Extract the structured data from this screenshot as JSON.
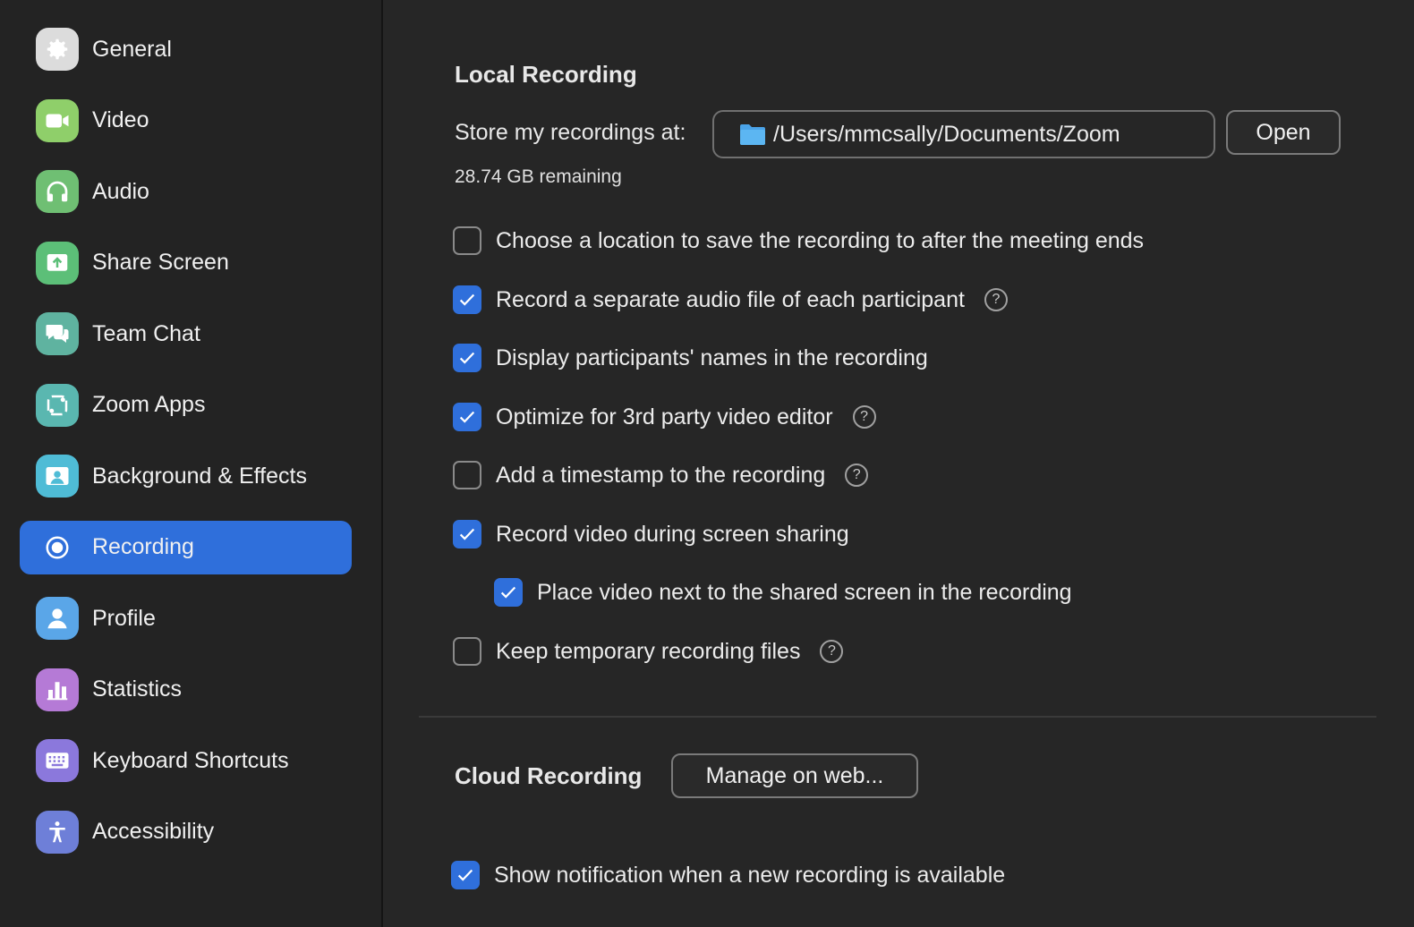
{
  "sidebar": {
    "items": [
      {
        "label": "General",
        "icon": "gear-icon",
        "color": "#dcdcdc",
        "active": false
      },
      {
        "label": "Video",
        "icon": "video-camera-icon",
        "color": "#8fcf6a",
        "active": false
      },
      {
        "label": "Audio",
        "icon": "headphones-icon",
        "color": "#6fbf73",
        "active": false
      },
      {
        "label": "Share Screen",
        "icon": "share-screen-icon",
        "color": "#5cbf78",
        "active": false
      },
      {
        "label": "Team Chat",
        "icon": "chat-bubbles-icon",
        "color": "#5fb3a0",
        "active": false
      },
      {
        "label": "Zoom Apps",
        "icon": "apps-icon",
        "color": "#5ab7b0",
        "active": false
      },
      {
        "label": "Background & Effects",
        "icon": "background-portrait-icon",
        "color": "#4fbcd6",
        "active": false
      },
      {
        "label": "Recording",
        "icon": "record-icon",
        "color": "#2f6fdb",
        "active": true
      },
      {
        "label": "Profile",
        "icon": "person-icon",
        "color": "#5aa6e8",
        "active": false
      },
      {
        "label": "Statistics",
        "icon": "bar-chart-icon",
        "color": "#b57ad6",
        "active": false
      },
      {
        "label": "Keyboard Shortcuts",
        "icon": "keyboard-icon",
        "color": "#8b78dc",
        "active": false
      },
      {
        "label": "Accessibility",
        "icon": "accessibility-icon",
        "color": "#6e7fd8",
        "active": false
      }
    ]
  },
  "local": {
    "title": "Local Recording",
    "store_label": "Store my recordings at:",
    "path": "/Users/mmcsally/Documents/Zoom",
    "open_label": "Open",
    "remaining": "28.74 GB remaining",
    "options": [
      {
        "label": "Choose a location to save the recording to after the meeting ends",
        "checked": false,
        "help": false
      },
      {
        "label": "Record a separate audio file of each participant",
        "checked": true,
        "help": true
      },
      {
        "label": "Display participants' names in the recording",
        "checked": true,
        "help": false
      },
      {
        "label": "Optimize for 3rd party video editor",
        "checked": true,
        "help": true
      },
      {
        "label": "Add a timestamp to the recording",
        "checked": false,
        "help": true
      },
      {
        "label": "Record video during screen sharing",
        "checked": true,
        "help": false
      },
      {
        "label": "Place video next to the shared screen in the recording",
        "checked": true,
        "help": false
      },
      {
        "label": "Keep temporary recording files",
        "checked": false,
        "help": true
      }
    ]
  },
  "cloud": {
    "title": "Cloud Recording",
    "manage_label": "Manage on web...",
    "notify_label": "Show notification when a new recording is available",
    "notify_checked": true
  },
  "help_glyph": "?",
  "accent_color": "#2f6fdb"
}
